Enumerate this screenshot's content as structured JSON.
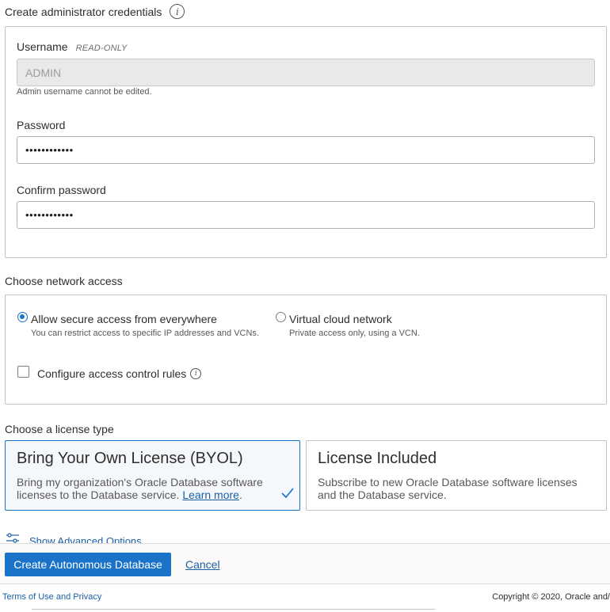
{
  "credentials": {
    "section_title": "Create administrator credentials",
    "username_label": "Username",
    "readonly_tag": "READ-ONLY",
    "username_value": "ADMIN",
    "username_helper": "Admin username cannot be edited.",
    "password_label": "Password",
    "password_value": "••••••••••••",
    "confirm_label": "Confirm password",
    "confirm_value": "••••••••••••"
  },
  "network": {
    "section_title": "Choose network access",
    "options": [
      {
        "label": "Allow secure access from everywhere",
        "help": "You can restrict access to specific IP addresses and VCNs.",
        "selected": true
      },
      {
        "label": "Virtual cloud network",
        "help": "Private access only, using a VCN.",
        "selected": false
      }
    ],
    "acl_label": "Configure access control rules"
  },
  "license": {
    "section_title": "Choose a license type",
    "cards": [
      {
        "title": "Bring Your Own License (BYOL)",
        "desc_line1": "Bring my organization's Oracle Database software",
        "desc_line2": "licenses to the Database service.",
        "link": "Learn more",
        "selected": true
      },
      {
        "title": "License Included",
        "desc_line1": "Subscribe to new Oracle Database software licenses",
        "desc_line2": "and the Database service.",
        "selected": false
      }
    ]
  },
  "advanced_label": "Show Advanced Options",
  "actions": {
    "create_label": "Create Autonomous Database",
    "cancel_label": "Cancel"
  },
  "footer": {
    "terms": "Terms of Use and Privacy",
    "copyright": "Copyright © 2020, Oracle and/"
  },
  "colors": {
    "accent": "#1a73c9",
    "link": "#1a5fa6",
    "text": "#312d2a"
  }
}
